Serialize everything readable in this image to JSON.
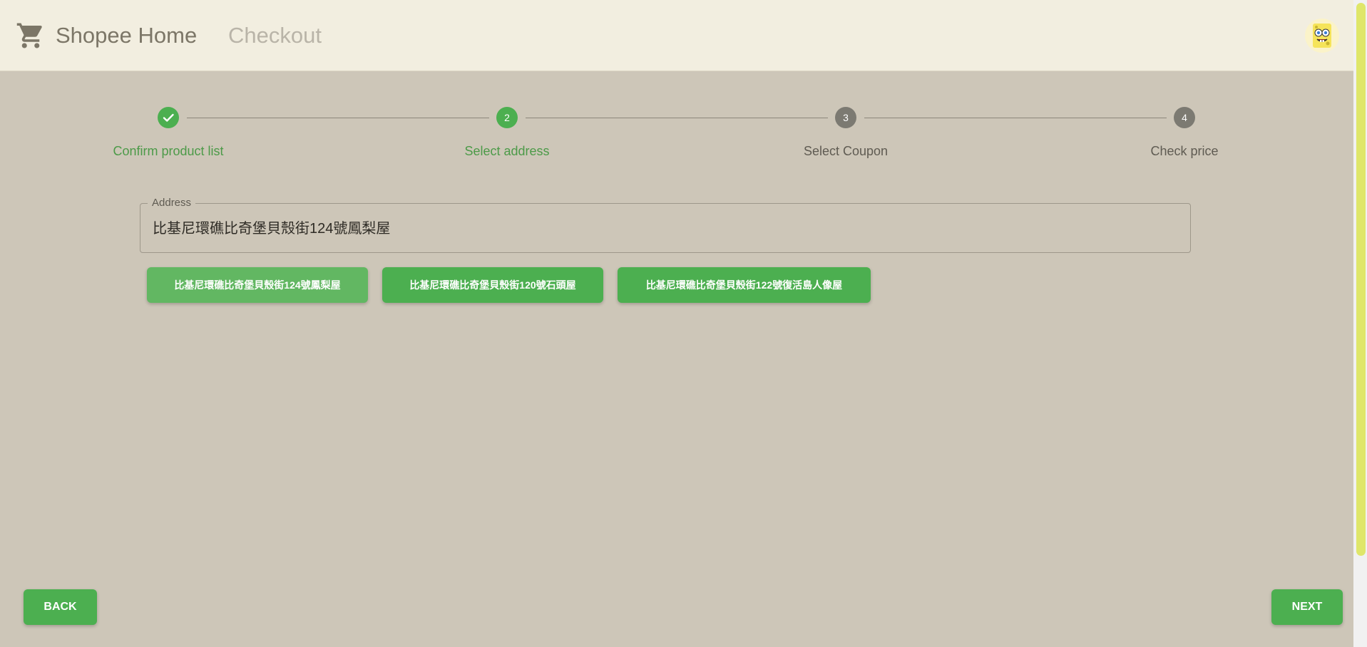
{
  "appbar": {
    "brand": "Shopee Home",
    "breadcrumb": "Checkout",
    "cart_icon": "shopping-cart-icon",
    "avatar_icon": "user-avatar-icon"
  },
  "stepper": {
    "steps": [
      {
        "number": "1",
        "label": "Confirm product list",
        "state": "completed"
      },
      {
        "number": "2",
        "label": "Select address",
        "state": "active"
      },
      {
        "number": "3",
        "label": "Select Coupon",
        "state": "pending"
      },
      {
        "number": "4",
        "label": "Check price",
        "state": "pending"
      }
    ]
  },
  "address": {
    "label": "Address",
    "value": "比基尼環礁比奇堡貝殼街124號鳳梨屋"
  },
  "suggestions": [
    {
      "label": "比基尼環礁比奇堡貝殼街124號鳳梨屋",
      "selected": true
    },
    {
      "label": "比基尼環礁比奇堡貝殼街120號石頭屋",
      "selected": false
    },
    {
      "label": "比基尼環礁比奇堡貝殼街122號復活島人像屋",
      "selected": false
    }
  ],
  "actions": {
    "back_label": "BACK",
    "next_label": "NEXT"
  },
  "colors": {
    "accent": "#4caf50",
    "appbar_bg": "#f2eee0",
    "page_bg": "#cdc6b8",
    "pending_step": "#7c7a72",
    "scroll_thumb": "#dfe66a"
  }
}
